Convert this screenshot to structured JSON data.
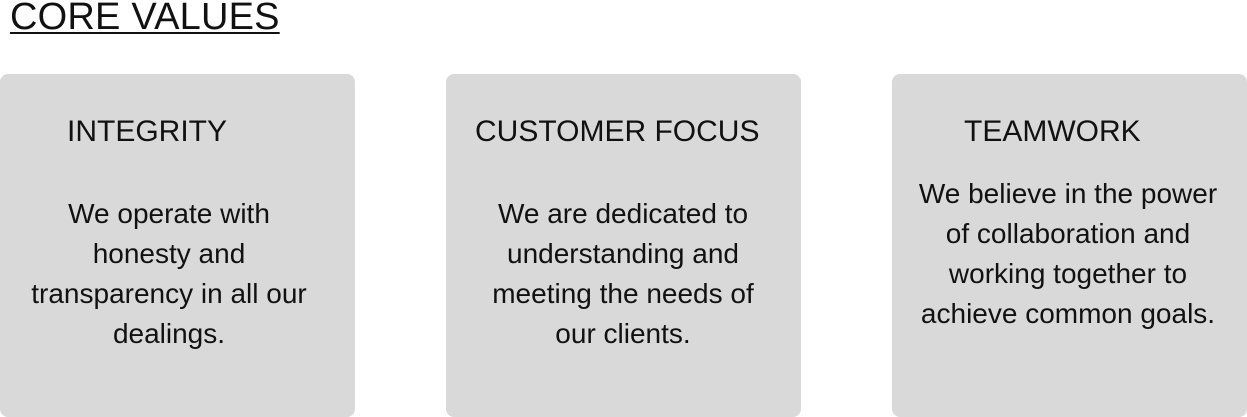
{
  "section": {
    "title": "CORE VALUES"
  },
  "values": [
    {
      "title": "INTEGRITY",
      "description": "We operate with honesty and transparency in all our dealings."
    },
    {
      "title": "CUSTOMER FOCUS",
      "description": "We are dedicated to understanding and meeting the needs of our clients."
    },
    {
      "title": "TEAMWORK",
      "description": "We believe in the power of collaboration and working together to achieve common goals."
    }
  ],
  "colors": {
    "card_background": "#d9d9d9",
    "text": "#111111",
    "page_background": "#ffffff"
  }
}
